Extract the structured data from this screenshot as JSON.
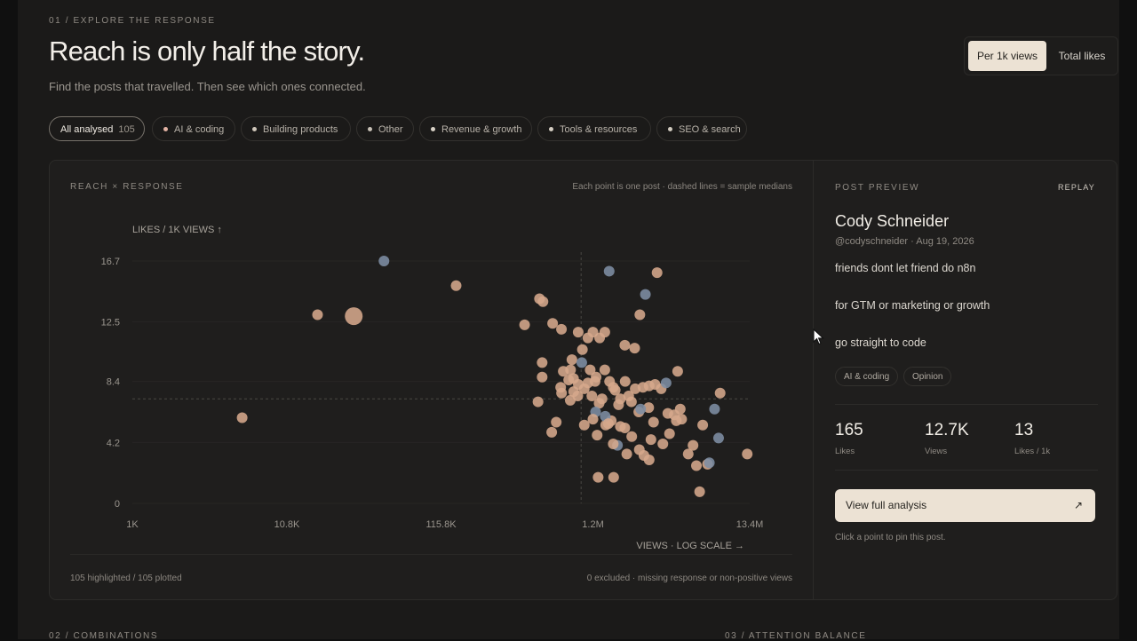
{
  "header": {
    "eyebrow": "01 / EXPLORE THE RESPONSE",
    "title": "Reach is only half the story.",
    "subtitle": "Find the posts that travelled. Then see which ones connected.",
    "toggle": {
      "active": "Per 1k views",
      "inactive": "Total likes"
    }
  },
  "filters": [
    {
      "label": "All analysed",
      "count": "105",
      "active": true
    },
    {
      "label": "AI & coding",
      "color": "#e3b3a4"
    },
    {
      "label": "Building products",
      "color": "#cfc6ba"
    },
    {
      "label": "Other",
      "color": "#c8c1b6"
    },
    {
      "label": "Revenue & growth",
      "color": "#d9d2c7"
    },
    {
      "label": "Tools & resources",
      "color": "#d6cfc4"
    },
    {
      "label": "SEO & search",
      "color": "#d2cbc0"
    }
  ],
  "chart_panel": {
    "label": "REACH × RESPONSE",
    "note": "Each point is one post · dashed lines = sample medians",
    "foot_left": "105 highlighted / 105 plotted",
    "foot_right": "0 excluded · missing response or non-positive views"
  },
  "chart_data": {
    "type": "scatter",
    "ylabel": "LIKES / 1K VIEWS ↑",
    "xlabel": "VIEWS · LOG SCALE →",
    "x_scale": "log",
    "xlim": [
      1000,
      13400000
    ],
    "ylim": [
      0,
      16.7
    ],
    "x_ticks": [
      1000,
      10800,
      115800,
      1200000,
      13400000
    ],
    "x_tick_labels": [
      "1K",
      "10.8K",
      "115.8K",
      "1.2M",
      "13.4M"
    ],
    "y_ticks": [
      0,
      4.2,
      8.4,
      12.5,
      16.7
    ],
    "y_tick_labels": [
      "0",
      "4.2",
      "8.4",
      "12.5",
      "16.7"
    ],
    "median_x": 1000000,
    "median_y": 7.2,
    "grid": true,
    "colors": {
      "peach": "#d6a88c",
      "blue": "#7e8ea4"
    },
    "points": [
      {
        "x": 5420,
        "y": 5.9,
        "c": "peach"
      },
      {
        "x": 17300,
        "y": 13.0,
        "c": "peach"
      },
      {
        "x": 30200,
        "y": 12.9,
        "c": "peach",
        "s": 10
      },
      {
        "x": 48100,
        "y": 16.7,
        "c": "blue"
      },
      {
        "x": 146000,
        "y": 15.0,
        "c": "peach"
      },
      {
        "x": 419000,
        "y": 12.3,
        "c": "peach"
      },
      {
        "x": 527000,
        "y": 14.1,
        "c": "peach"
      },
      {
        "x": 556000,
        "y": 13.9,
        "c": "peach"
      },
      {
        "x": 645000,
        "y": 12.4,
        "c": "peach"
      },
      {
        "x": 739000,
        "y": 12.0,
        "c": "peach"
      },
      {
        "x": 549000,
        "y": 9.7,
        "c": "peach"
      },
      {
        "x": 549000,
        "y": 8.7,
        "c": "peach"
      },
      {
        "x": 515000,
        "y": 7.0,
        "c": "peach"
      },
      {
        "x": 682000,
        "y": 5.6,
        "c": "peach"
      },
      {
        "x": 636000,
        "y": 4.9,
        "c": "peach"
      },
      {
        "x": 850000,
        "y": 9.2,
        "c": "peach"
      },
      {
        "x": 868000,
        "y": 9.9,
        "c": "peach"
      },
      {
        "x": 956000,
        "y": 11.8,
        "c": "peach"
      },
      {
        "x": 1010000,
        "y": 9.7,
        "c": "blue"
      },
      {
        "x": 1110000,
        "y": 11.4,
        "c": "peach"
      },
      {
        "x": 1200000,
        "y": 11.8,
        "c": "peach"
      },
      {
        "x": 826000,
        "y": 8.5,
        "c": "peach"
      },
      {
        "x": 958000,
        "y": 8.2,
        "c": "peach"
      },
      {
        "x": 892000,
        "y": 7.7,
        "c": "peach"
      },
      {
        "x": 846000,
        "y": 7.1,
        "c": "peach"
      },
      {
        "x": 1050000,
        "y": 7.9,
        "c": "peach"
      },
      {
        "x": 1180000,
        "y": 7.4,
        "c": "peach"
      },
      {
        "x": 1260000,
        "y": 8.7,
        "c": "peach"
      },
      {
        "x": 1440000,
        "y": 9.2,
        "c": "peach"
      },
      {
        "x": 1550000,
        "y": 8.4,
        "c": "peach"
      },
      {
        "x": 1690000,
        "y": 7.8,
        "c": "peach"
      },
      {
        "x": 1830000,
        "y": 7.2,
        "c": "peach"
      },
      {
        "x": 1970000,
        "y": 8.4,
        "c": "peach"
      },
      {
        "x": 1320000,
        "y": 6.9,
        "c": "peach"
      },
      {
        "x": 1460000,
        "y": 5.4,
        "c": "peach"
      },
      {
        "x": 1050000,
        "y": 5.4,
        "c": "peach"
      },
      {
        "x": 1280000,
        "y": 4.7,
        "c": "peach"
      },
      {
        "x": 1590000,
        "y": 5.7,
        "c": "peach"
      },
      {
        "x": 1830000,
        "y": 5.3,
        "c": "peach"
      },
      {
        "x": 1650000,
        "y": 1.8,
        "c": "peach"
      },
      {
        "x": 1540000,
        "y": 16.0,
        "c": "blue"
      },
      {
        "x": 2470000,
        "y": 13.0,
        "c": "peach"
      },
      {
        "x": 2690000,
        "y": 14.4,
        "c": "blue"
      },
      {
        "x": 3220000,
        "y": 15.9,
        "c": "peach"
      },
      {
        "x": 2280000,
        "y": 10.7,
        "c": "peach"
      },
      {
        "x": 1960000,
        "y": 10.9,
        "c": "peach"
      },
      {
        "x": 2080000,
        "y": 7.4,
        "c": "peach"
      },
      {
        "x": 2300000,
        "y": 7.9,
        "c": "peach"
      },
      {
        "x": 2430000,
        "y": 6.3,
        "c": "peach"
      },
      {
        "x": 2590000,
        "y": 8.0,
        "c": "peach"
      },
      {
        "x": 2850000,
        "y": 8.1,
        "c": "peach"
      },
      {
        "x": 3050000,
        "y": 5.6,
        "c": "peach"
      },
      {
        "x": 2830000,
        "y": 6.6,
        "c": "peach"
      },
      {
        "x": 3120000,
        "y": 8.2,
        "c": "peach"
      },
      {
        "x": 3430000,
        "y": 7.9,
        "c": "peach"
      },
      {
        "x": 3700000,
        "y": 8.3,
        "c": "blue"
      },
      {
        "x": 4200000,
        "y": 6.1,
        "c": "peach"
      },
      {
        "x": 4700000,
        "y": 5.8,
        "c": "peach"
      },
      {
        "x": 3900000,
        "y": 4.8,
        "c": "peach"
      },
      {
        "x": 3520000,
        "y": 4.1,
        "c": "peach"
      },
      {
        "x": 2930000,
        "y": 4.4,
        "c": "peach"
      },
      {
        "x": 2450000,
        "y": 3.7,
        "c": "peach"
      },
      {
        "x": 2850000,
        "y": 3.0,
        "c": "peach"
      },
      {
        "x": 2630000,
        "y": 3.3,
        "c": "peach"
      },
      {
        "x": 2020000,
        "y": 3.4,
        "c": "peach"
      },
      {
        "x": 1750000,
        "y": 4.0,
        "c": "blue"
      },
      {
        "x": 1250000,
        "y": 6.3,
        "c": "blue"
      },
      {
        "x": 1450000,
        "y": 6.0,
        "c": "blue"
      },
      {
        "x": 2500000,
        "y": 6.5,
        "c": "blue"
      },
      {
        "x": 4420000,
        "y": 9.1,
        "c": "peach"
      },
      {
        "x": 4600000,
        "y": 6.5,
        "c": "peach"
      },
      {
        "x": 5200000,
        "y": 3.4,
        "c": "peach"
      },
      {
        "x": 5900000,
        "y": 2.6,
        "c": "peach"
      },
      {
        "x": 7000000,
        "y": 2.7,
        "c": "peach"
      },
      {
        "x": 6200000,
        "y": 0.8,
        "c": "peach"
      },
      {
        "x": 7200000,
        "y": 2.8,
        "c": "blue"
      },
      {
        "x": 6500000,
        "y": 5.4,
        "c": "peach"
      },
      {
        "x": 8300000,
        "y": 4.5,
        "c": "blue"
      },
      {
        "x": 7800000,
        "y": 6.5,
        "c": "blue"
      },
      {
        "x": 8500000,
        "y": 7.6,
        "c": "peach"
      },
      {
        "x": 12900000,
        "y": 3.4,
        "c": "peach"
      },
      {
        "x": 5600000,
        "y": 4.0,
        "c": "peach"
      },
      {
        "x": 1300000,
        "y": 1.8,
        "c": "peach"
      },
      {
        "x": 1380000,
        "y": 7.2,
        "c": "peach"
      },
      {
        "x": 1640000,
        "y": 8.0,
        "c": "peach"
      },
      {
        "x": 1780000,
        "y": 6.8,
        "c": "peach"
      },
      {
        "x": 2170000,
        "y": 7.0,
        "c": "peach"
      },
      {
        "x": 760000,
        "y": 9.1,
        "c": "peach"
      },
      {
        "x": 950000,
        "y": 7.4,
        "c": "peach"
      },
      {
        "x": 1110000,
        "y": 8.3,
        "c": "peach"
      },
      {
        "x": 1240000,
        "y": 8.4,
        "c": "peach"
      },
      {
        "x": 730000,
        "y": 8.0,
        "c": "peach"
      },
      {
        "x": 740000,
        "y": 7.6,
        "c": "peach"
      },
      {
        "x": 890000,
        "y": 8.6,
        "c": "peach"
      },
      {
        "x": 1020000,
        "y": 10.6,
        "c": "peach"
      },
      {
        "x": 1330000,
        "y": 11.4,
        "c": "peach"
      },
      {
        "x": 1150000,
        "y": 9.2,
        "c": "peach"
      },
      {
        "x": 1200000,
        "y": 5.8,
        "c": "peach"
      },
      {
        "x": 1640000,
        "y": 4.1,
        "c": "peach"
      },
      {
        "x": 1960000,
        "y": 5.2,
        "c": "peach"
      },
      {
        "x": 2180000,
        "y": 4.6,
        "c": "peach"
      },
      {
        "x": 3800000,
        "y": 6.2,
        "c": "peach"
      },
      {
        "x": 1440000,
        "y": 11.8,
        "c": "peach"
      },
      {
        "x": 4330000,
        "y": 5.7,
        "c": "peach"
      },
      {
        "x": 1520000,
        "y": 5.5,
        "c": "peach"
      }
    ]
  },
  "preview": {
    "label": "POST PREVIEW",
    "replay": "REPLAY",
    "name": "Cody Schneider",
    "handle": "@codyschneider · Aug 19, 2026",
    "lines": [
      "friends dont let friend do n8n",
      "for GTM or marketing or growth",
      "go straight to code"
    ],
    "tags": [
      "AI & coding",
      "Opinion"
    ],
    "stats": [
      {
        "value": "165",
        "label": "Likes"
      },
      {
        "value": "12.7K",
        "label": "Views"
      },
      {
        "value": "13",
        "label": "Likes / 1k"
      }
    ],
    "cta": "View full analysis",
    "hint": "Click a point to pin this post."
  },
  "sections_below": {
    "left": "02 / COMBINATIONS",
    "right": "03 / ATTENTION BALANCE"
  }
}
